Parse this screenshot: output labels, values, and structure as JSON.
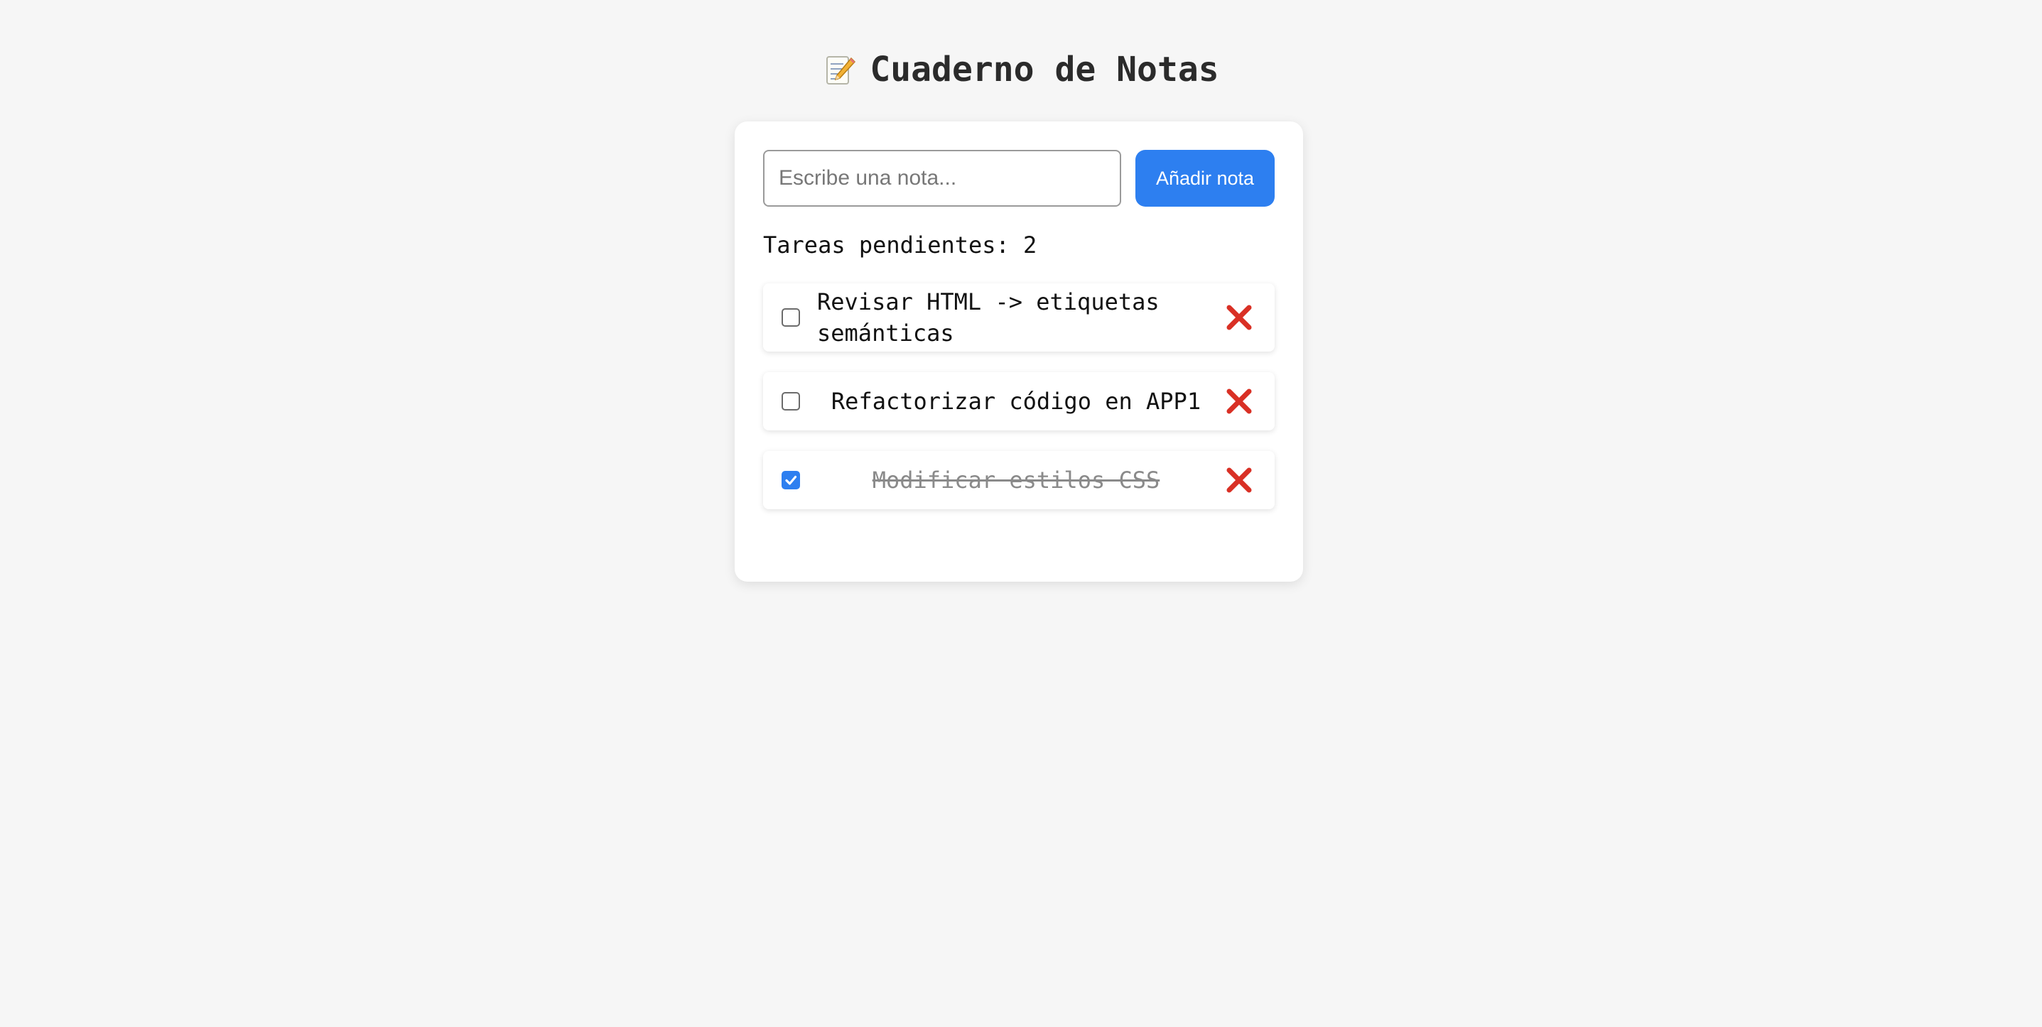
{
  "header": {
    "title": "Cuaderno de Notas",
    "icon": "memo-pencil-icon"
  },
  "form": {
    "input_placeholder": "Escribe una nota...",
    "input_value": "",
    "add_label": "Añadir nota"
  },
  "summary": {
    "label": "Tareas pendientes:",
    "count": "2"
  },
  "tasks": [
    {
      "text": "Revisar HTML -> etiquetas semánticas",
      "done": false
    },
    {
      "text": "Refactorizar código en APP1",
      "done": false
    },
    {
      "text": "Modificar estilos CSS",
      "done": true
    }
  ],
  "colors": {
    "accent": "#2d7ff0",
    "delete": "#d93025",
    "background": "#f6f6f6"
  }
}
